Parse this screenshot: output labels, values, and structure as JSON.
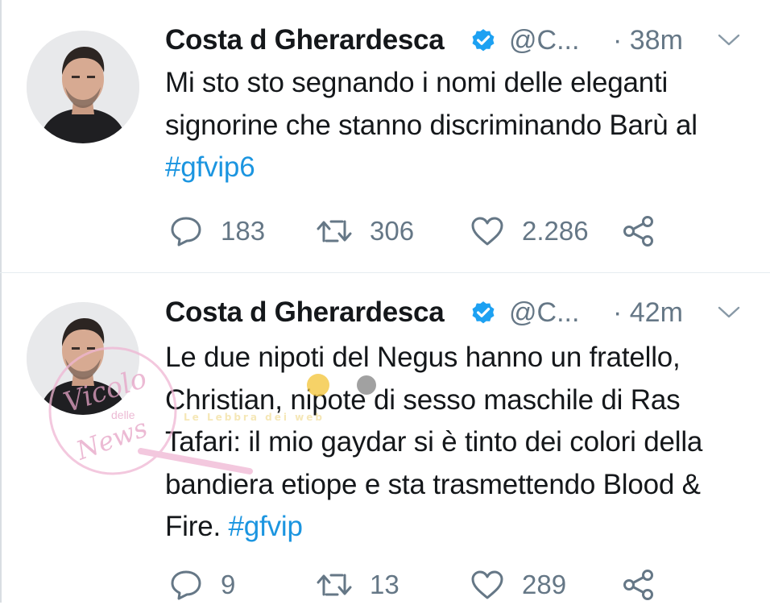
{
  "tweets": [
    {
      "author_name": "Costa d Gherardesca",
      "handle": "@C...",
      "time": "· 38m",
      "text_before": "Mi sto sto segnando i nomi delle eleganti signorine che stanno discriminando Barù al ",
      "hashtag": "#gfvip6",
      "replies": "183",
      "retweets": "306",
      "likes": "2.286",
      "icons": {
        "verified": "verified-badge-icon",
        "menu": "chevron-down-icon",
        "reply": "reply-icon",
        "retweet": "retweet-icon",
        "like": "heart-icon",
        "share": "share-icon"
      }
    },
    {
      "author_name": "Costa d Gherardesca",
      "handle": "@C...",
      "time": "· 42m",
      "text_before": "Le due nipoti del Negus hanno un fratello, Christian, nipote di sesso maschile di Ras Tafari: il mio gaydar si è tinto dei colori della bandiera etiope e sta trasmettendo Blood & Fire. ",
      "hashtag": "#gfvip",
      "replies": "9",
      "retweets": "13",
      "likes": "289",
      "icons": {
        "verified": "verified-badge-icon",
        "menu": "chevron-down-icon",
        "reply": "reply-icon",
        "retweet": "retweet-icon",
        "like": "heart-icon",
        "share": "share-icon"
      }
    }
  ],
  "watermark": {
    "logo_line1": "Vicolo",
    "logo_line2": "delle",
    "logo_line3": "News",
    "banner": "Le Lebbra dei web"
  },
  "colors": {
    "text": "#14171a",
    "secondary": "#657786",
    "link": "#1b95e0",
    "verified": "#1da1f2",
    "watermark": "#e6a3c6"
  }
}
